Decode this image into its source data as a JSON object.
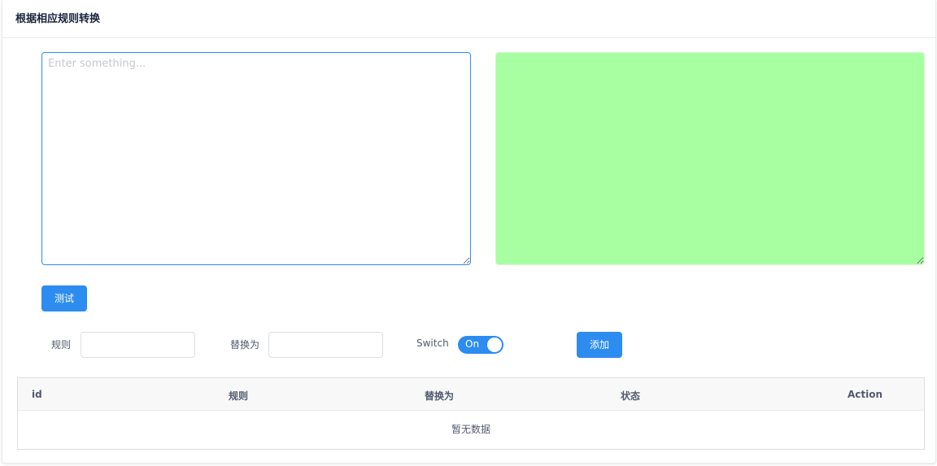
{
  "card": {
    "title": "根据相应规则转换"
  },
  "input": {
    "placeholder": "Enter something...",
    "value": ""
  },
  "output": {
    "value": "",
    "bg_color": "#a8ffa2"
  },
  "buttons": {
    "test_label": "测试",
    "add_label": "添加"
  },
  "form": {
    "rule_label": "规则",
    "rule_value": "",
    "replace_label": "替换为",
    "replace_value": "",
    "switch_label": "Switch",
    "switch_state": "On"
  },
  "table": {
    "columns": [
      "id",
      "规则",
      "替换为",
      "状态",
      "Action"
    ],
    "empty_text": "暂无数据"
  },
  "colors": {
    "primary": "#2d8cf0",
    "output_bg": "#a8ffa2"
  }
}
